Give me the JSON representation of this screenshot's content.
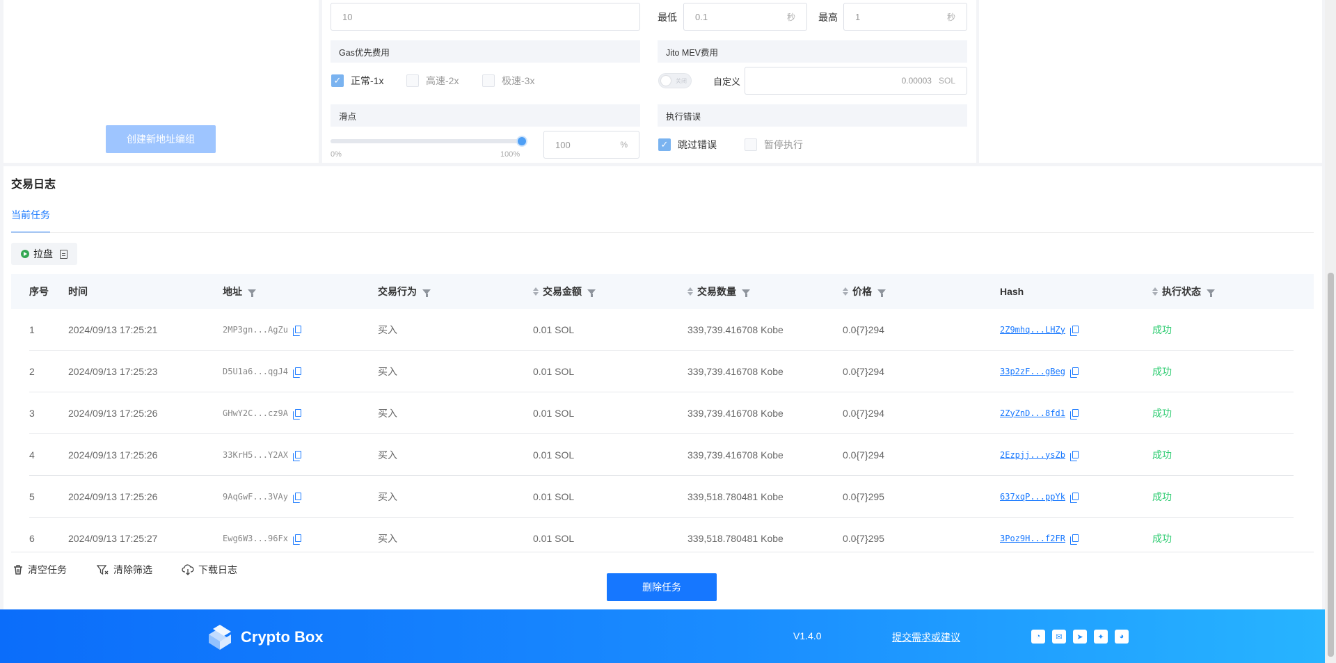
{
  "settings": {
    "create_group_label": "创建新地址编组",
    "count_value": "10",
    "interval": {
      "min_label": "最低",
      "min_value": "0.1",
      "max_label": "最高",
      "max_value": "1",
      "unit": "秒"
    },
    "gas": {
      "title": "Gas优先费用",
      "options": [
        {
          "label": "正常-1x",
          "checked": true
        },
        {
          "label": "高速-2x",
          "checked": false
        },
        {
          "label": "极速-3x",
          "checked": false
        }
      ]
    },
    "jito": {
      "title": "Jito MEV费用",
      "toggle_text": "关闭",
      "toggle_on": false,
      "custom_label": "自定义",
      "custom_value": "0.00003",
      "unit": "SOL"
    },
    "slippage": {
      "title": "滑点",
      "min_label": "0%",
      "max_label": "100%",
      "value": "100",
      "unit": "%",
      "level_percent": 100
    },
    "error": {
      "title": "执行错误",
      "options": [
        {
          "label": "跳过错误",
          "checked": true
        },
        {
          "label": "暂停执行",
          "checked": false
        }
      ]
    }
  },
  "log": {
    "title": "交易日志",
    "tab_current": "当前任务",
    "task_name": "拉盘",
    "columns": {
      "index": "序号",
      "time": "时间",
      "address": "地址",
      "action": "交易行为",
      "amount": "交易金额",
      "quantity": "交易数量",
      "price": "价格",
      "hash": "Hash",
      "status": "执行状态"
    },
    "rows": [
      {
        "index": "1",
        "time": "2024/09/13 17:25:21",
        "address": "2MP3gn...AgZu",
        "action": "买入",
        "amount": "0.01 SOL",
        "quantity": "339,739.416708 Kobe",
        "price": "0.0{7}294",
        "hash": "2Z9mhq...LHZy",
        "status": "成功"
      },
      {
        "index": "2",
        "time": "2024/09/13 17:25:23",
        "address": "D5U1a6...qgJ4",
        "action": "买入",
        "amount": "0.01 SOL",
        "quantity": "339,739.416708 Kobe",
        "price": "0.0{7}294",
        "hash": "33p2zF...gBeg",
        "status": "成功"
      },
      {
        "index": "3",
        "time": "2024/09/13 17:25:26",
        "address": "GHwY2C...cz9A",
        "action": "买入",
        "amount": "0.01 SOL",
        "quantity": "339,739.416708 Kobe",
        "price": "0.0{7}294",
        "hash": "2ZyZnD...8fd1",
        "status": "成功"
      },
      {
        "index": "4",
        "time": "2024/09/13 17:25:26",
        "address": "33KrH5...Y2AX",
        "action": "买入",
        "amount": "0.01 SOL",
        "quantity": "339,739.416708 Kobe",
        "price": "0.0{7}294",
        "hash": "2Ezpjj...ysZb",
        "status": "成功"
      },
      {
        "index": "5",
        "time": "2024/09/13 17:25:26",
        "address": "9AqGwF...3VAy",
        "action": "买入",
        "amount": "0.01 SOL",
        "quantity": "339,518.780481 Kobe",
        "price": "0.0{7}295",
        "hash": "637xqP...ppYk",
        "status": "成功"
      },
      {
        "index": "6",
        "time": "2024/09/13 17:25:27",
        "address": "Ewg6W3...96Fx",
        "action": "买入",
        "amount": "0.01 SOL",
        "quantity": "339,518.780481 Kobe",
        "price": "0.0{7}295",
        "hash": "3Poz9H...f2FR",
        "status": "成功"
      }
    ],
    "actions": {
      "clear_task": "清空任务",
      "clear_filter": "清除筛选",
      "download_log": "下载日志"
    },
    "delete_task": "删除任务"
  },
  "footer": {
    "brand": "Crypto Box",
    "version": "V1.4.0",
    "suggest_link": "提交需求或建议",
    "social_icons": [
      "wechat-icon",
      "email-icon",
      "telegram-icon",
      "twitter-icon",
      "discord-icon"
    ]
  },
  "colors": {
    "primary": "#1677ff",
    "success": "#2ecc71",
    "disabled_primary": "#9ec5ff"
  }
}
